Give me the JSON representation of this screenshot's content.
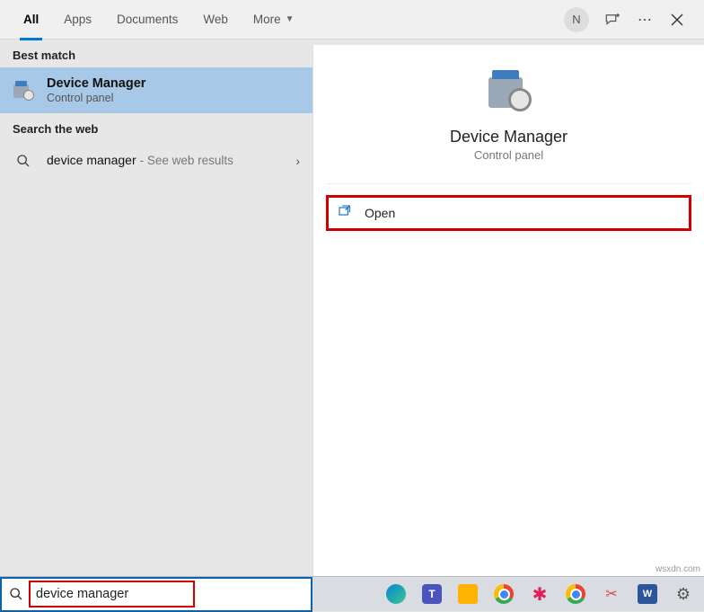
{
  "tabs": [
    "All",
    "Apps",
    "Documents",
    "Web",
    "More"
  ],
  "active_tab": 0,
  "avatar_initial": "N",
  "sections": {
    "best_match": "Best match",
    "search_web": "Search the web"
  },
  "best_match_result": {
    "title": "Device Manager",
    "subtitle": "Control panel"
  },
  "web_result": {
    "query": "device manager",
    "suffix": "- See web results"
  },
  "preview": {
    "title": "Device Manager",
    "subtitle": "Control panel",
    "open_label": "Open"
  },
  "search_input": "device manager",
  "watermark": "wsxdn.com"
}
